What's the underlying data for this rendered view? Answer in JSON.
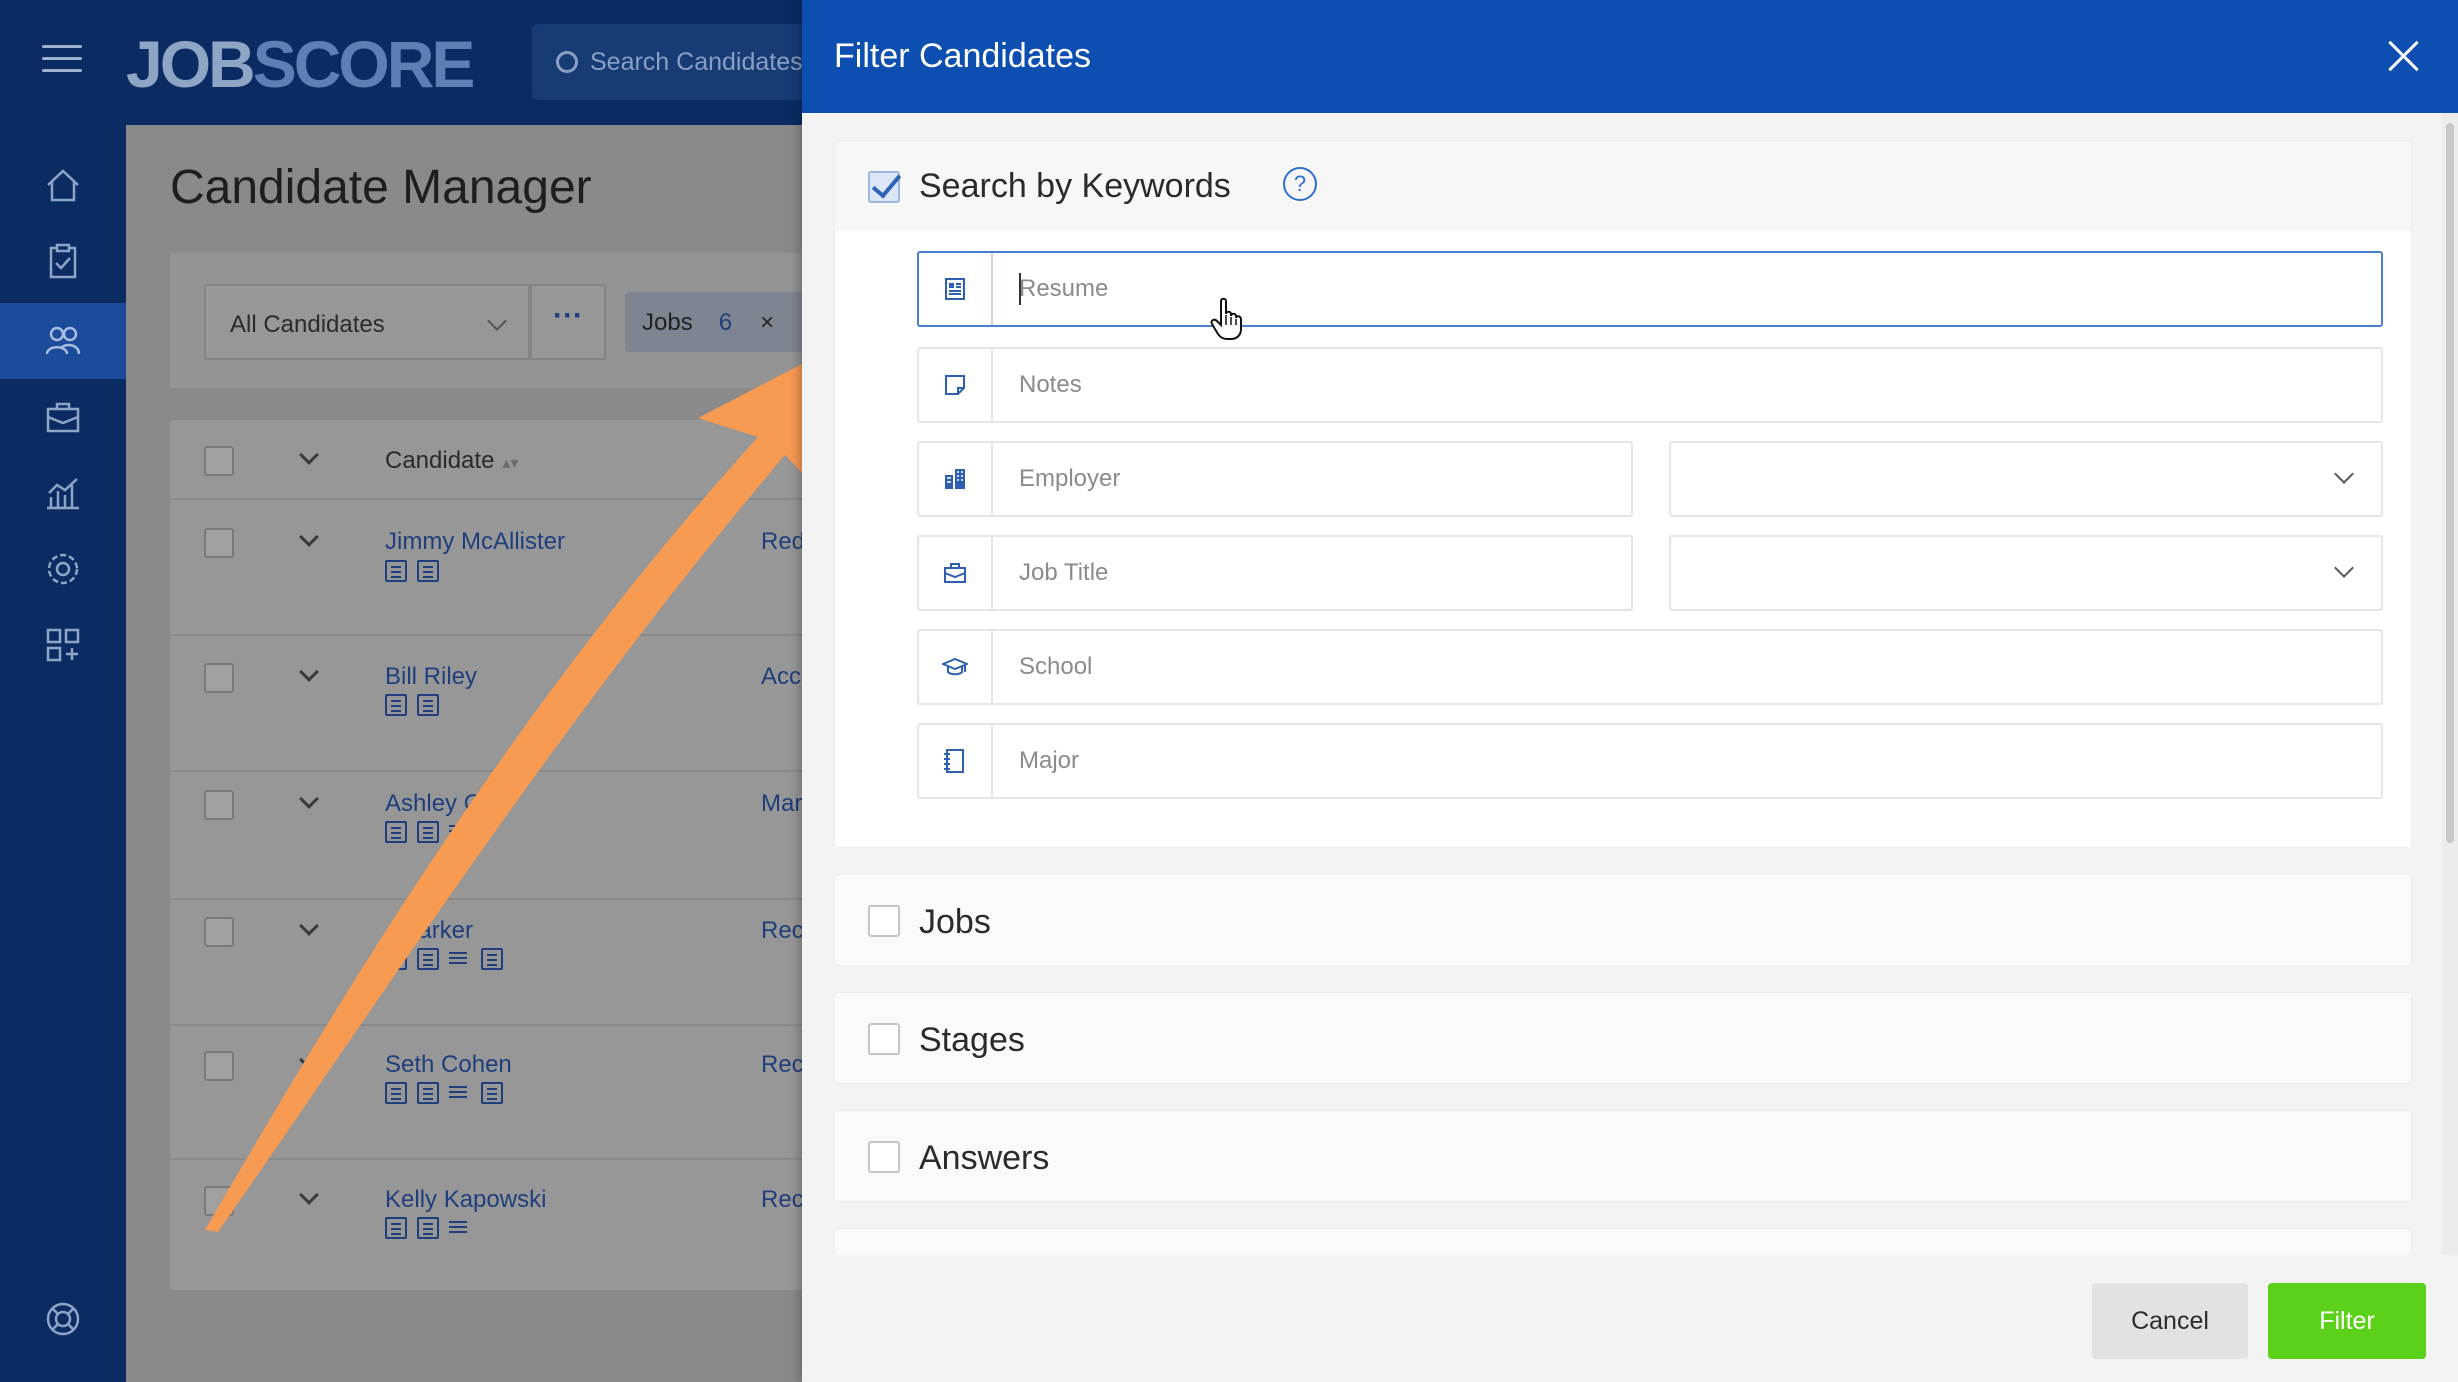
{
  "app": {
    "logo_part1": "JOB",
    "logo_part2": "SCORE",
    "search_placeholder": "Search Candidates"
  },
  "sidebar": {
    "items": [
      {
        "icon": "home-icon"
      },
      {
        "icon": "clipboard-icon"
      },
      {
        "icon": "candidates-icon",
        "active": true
      },
      {
        "icon": "briefcase-icon"
      },
      {
        "icon": "analytics-icon"
      },
      {
        "icon": "settings-icon"
      },
      {
        "icon": "apps-icon"
      },
      {
        "icon": "help-lifebuoy-icon"
      }
    ]
  },
  "page": {
    "title": "Candidate Manager",
    "view_select": "All Candidates",
    "more_label": "···",
    "chip_label": "Jobs",
    "chip_count": "6",
    "chip_remove": "×",
    "column_candidate": "Candidate",
    "column_sort": "▴▾"
  },
  "candidates": [
    {
      "name": "Jimmy McAllister",
      "status": "Red"
    },
    {
      "name": "Bill Riley",
      "status": "Acc"
    },
    {
      "name": "Ashley Orv",
      "status": "Mar"
    },
    {
      "name": "Ali  arker",
      "status": "Rec"
    },
    {
      "name": "Seth Cohen",
      "status": "Rec"
    },
    {
      "name": "Kelly Kapowski",
      "status": "Rec"
    }
  ],
  "modal": {
    "title": "Filter Candidates",
    "keywords_title": "Search by Keywords",
    "help_glyph": "?",
    "fields": {
      "resume_placeholder": "Resume",
      "notes_placeholder": "Notes",
      "employer_placeholder": "Employer",
      "jobtitle_placeholder": "Job Title",
      "school_placeholder": "School",
      "major_placeholder": "Major"
    },
    "sections": {
      "jobs": "Jobs",
      "stages": "Stages",
      "answers": "Answers"
    },
    "cancel_label": "Cancel",
    "filter_label": "Filter"
  },
  "colors": {
    "header_blue": "#0d4fb0",
    "nav_dark": "#0a2c63",
    "filter_green": "#5bd11a",
    "arrow_orange": "#f79a52"
  }
}
